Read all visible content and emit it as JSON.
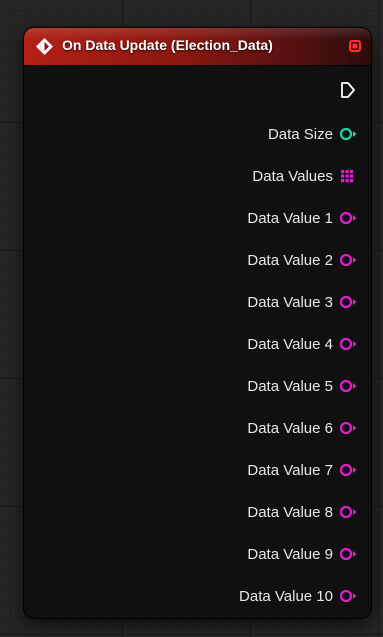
{
  "node": {
    "title": "On Data Update (Election_Data)",
    "header_color": "#b32016",
    "icon": "event-diamond-icon",
    "delegate_icon": "delegate-square-icon",
    "exec_icon": "exec-arrow-icon"
  },
  "colors": {
    "int_pin": "#1fd6a0",
    "object_pin": "#e31ed1",
    "delegate": "#ff3030"
  },
  "pins": [
    {
      "label": "Data Size",
      "type": "int",
      "icon": "circle-pin-icon"
    },
    {
      "label": "Data Values",
      "type": "array",
      "icon": "grid-array-icon"
    },
    {
      "label": "Data Value 1",
      "type": "object",
      "icon": "circle-pin-icon"
    },
    {
      "label": "Data Value 2",
      "type": "object",
      "icon": "circle-pin-icon"
    },
    {
      "label": "Data Value 3",
      "type": "object",
      "icon": "circle-pin-icon"
    },
    {
      "label": "Data Value 4",
      "type": "object",
      "icon": "circle-pin-icon"
    },
    {
      "label": "Data Value 5",
      "type": "object",
      "icon": "circle-pin-icon"
    },
    {
      "label": "Data Value 6",
      "type": "object",
      "icon": "circle-pin-icon"
    },
    {
      "label": "Data Value 7",
      "type": "object",
      "icon": "circle-pin-icon"
    },
    {
      "label": "Data Value 8",
      "type": "object",
      "icon": "circle-pin-icon"
    },
    {
      "label": "Data Value 9",
      "type": "object",
      "icon": "circle-pin-icon"
    },
    {
      "label": "Data Value 10",
      "type": "object",
      "icon": "circle-pin-icon"
    }
  ]
}
